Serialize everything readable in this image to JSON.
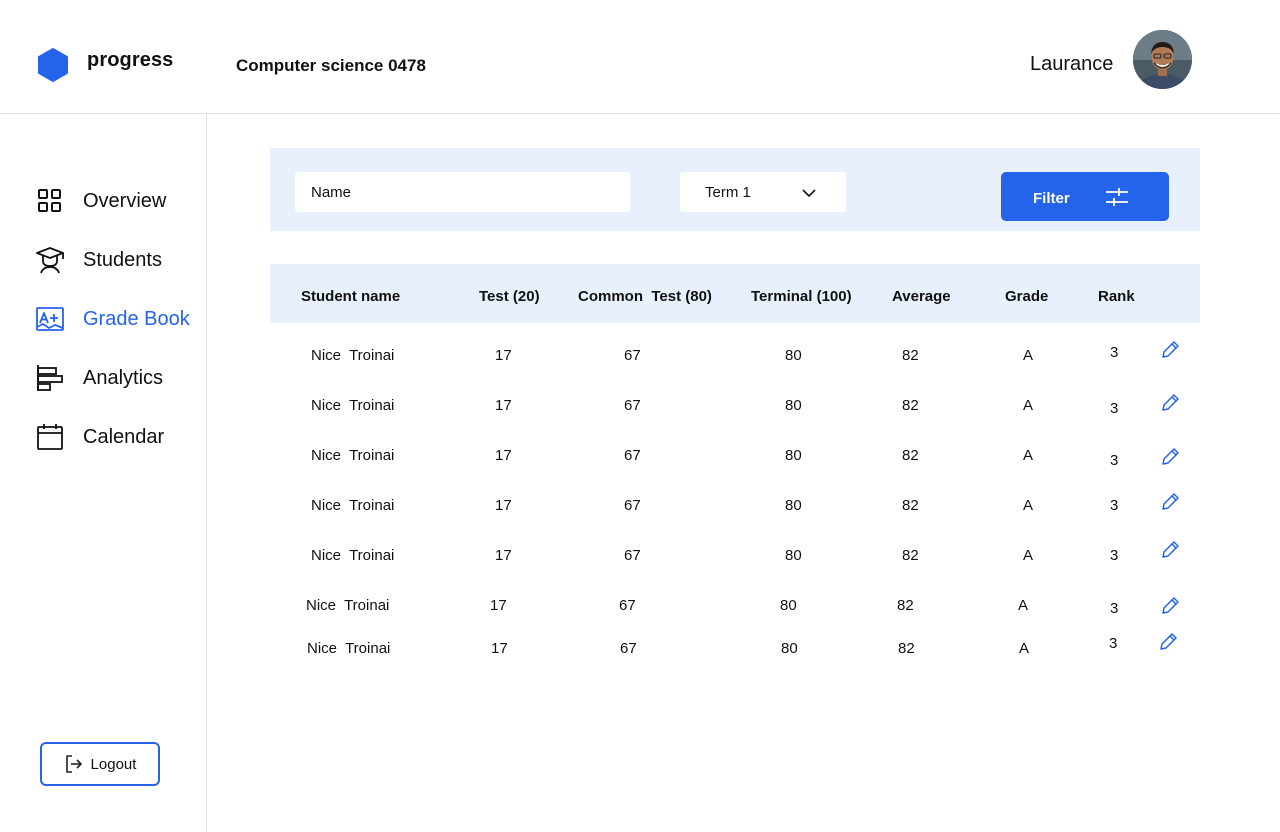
{
  "app": {
    "name": "progress",
    "accent_color": "#2563eb"
  },
  "header": {
    "course_title": "Computer science 0478",
    "user_name": "Laurance"
  },
  "sidebar": {
    "items": [
      {
        "label": "Overview",
        "icon": "grid-icon",
        "active": false
      },
      {
        "label": "Students",
        "icon": "graduate-icon",
        "active": false
      },
      {
        "label": "Grade Book",
        "icon": "grade-book-icon",
        "active": true
      },
      {
        "label": "Analytics",
        "icon": "bar-chart-icon",
        "active": false
      },
      {
        "label": "Calendar",
        "icon": "calendar-icon",
        "active": false
      }
    ],
    "logout_label": "Logout"
  },
  "filters": {
    "name_placeholder": "Name",
    "term_selected": "Term 1",
    "filter_label": "Filter"
  },
  "table": {
    "columns": [
      "Student name",
      "Test (20)",
      "Common  Test (80)",
      "Terminal (100)",
      "Average",
      "Grade",
      "Rank"
    ],
    "rows": [
      {
        "name": "Nice  Troinai",
        "test": "17",
        "common": "67",
        "terminal": "80",
        "average": "82",
        "grade": "A",
        "rank": "3"
      },
      {
        "name": "Nice  Troinai",
        "test": "17",
        "common": "67",
        "terminal": "80",
        "average": "82",
        "grade": "A",
        "rank": "3"
      },
      {
        "name": "Nice  Troinai",
        "test": "17",
        "common": "67",
        "terminal": "80",
        "average": "82",
        "grade": "A",
        "rank": "3"
      },
      {
        "name": "Nice  Troinai",
        "test": "17",
        "common": "67",
        "terminal": "80",
        "average": "82",
        "grade": "A",
        "rank": "3"
      },
      {
        "name": "Nice  Troinai",
        "test": "17",
        "common": "67",
        "terminal": "80",
        "average": "82",
        "grade": "A",
        "rank": "3"
      },
      {
        "name": "Nice  Troinai",
        "test": "17",
        "common": "67",
        "terminal": "80",
        "average": "82",
        "grade": "A",
        "rank": "3"
      },
      {
        "name": "Nice  Troinai",
        "test": "17",
        "common": "67",
        "terminal": "80",
        "average": "82",
        "grade": "A",
        "rank": "3"
      }
    ]
  }
}
